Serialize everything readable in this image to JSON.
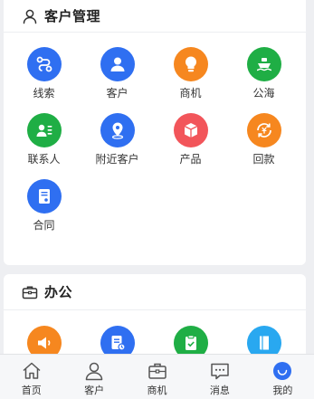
{
  "crm_section": {
    "title": "客户管理",
    "icon": "user-outline-icon",
    "apps": [
      {
        "label": "线索",
        "icon": "leads-icon",
        "color": "#2f6ff1"
      },
      {
        "label": "客户",
        "icon": "customer-icon",
        "color": "#2f6ff1"
      },
      {
        "label": "商机",
        "icon": "bulb-icon",
        "color": "#f6871f"
      },
      {
        "label": "公海",
        "icon": "ship-icon",
        "color": "#1fae45"
      },
      {
        "label": "联系人",
        "icon": "contacts-icon",
        "color": "#1fae45"
      },
      {
        "label": "附近客户",
        "icon": "location-icon",
        "color": "#2f6ff1"
      },
      {
        "label": "产品",
        "icon": "box-icon",
        "color": "#f2555a"
      },
      {
        "label": "回款",
        "icon": "payment-icon",
        "color": "#f6871f"
      },
      {
        "label": "合同",
        "icon": "contract-icon",
        "color": "#2f6ff1"
      }
    ]
  },
  "office_section": {
    "title": "办公",
    "icon": "briefcase-icon",
    "apps": [
      {
        "icon": "announcement-icon",
        "color": "#f6871f"
      },
      {
        "icon": "report-icon",
        "color": "#2f6ff1"
      },
      {
        "icon": "clipboard-icon",
        "color": "#1fae45"
      },
      {
        "icon": "book-icon",
        "color": "#29a8f0"
      }
    ]
  },
  "tabbar": {
    "tabs": [
      {
        "label": "首页",
        "icon": "home-icon"
      },
      {
        "label": "客户",
        "icon": "person-icon"
      },
      {
        "label": "商机",
        "icon": "briefcase-icon"
      },
      {
        "label": "消息",
        "icon": "message-icon"
      },
      {
        "label": "我的",
        "icon": "profile-icon",
        "active": true,
        "color": "#2f6ff1"
      }
    ]
  }
}
